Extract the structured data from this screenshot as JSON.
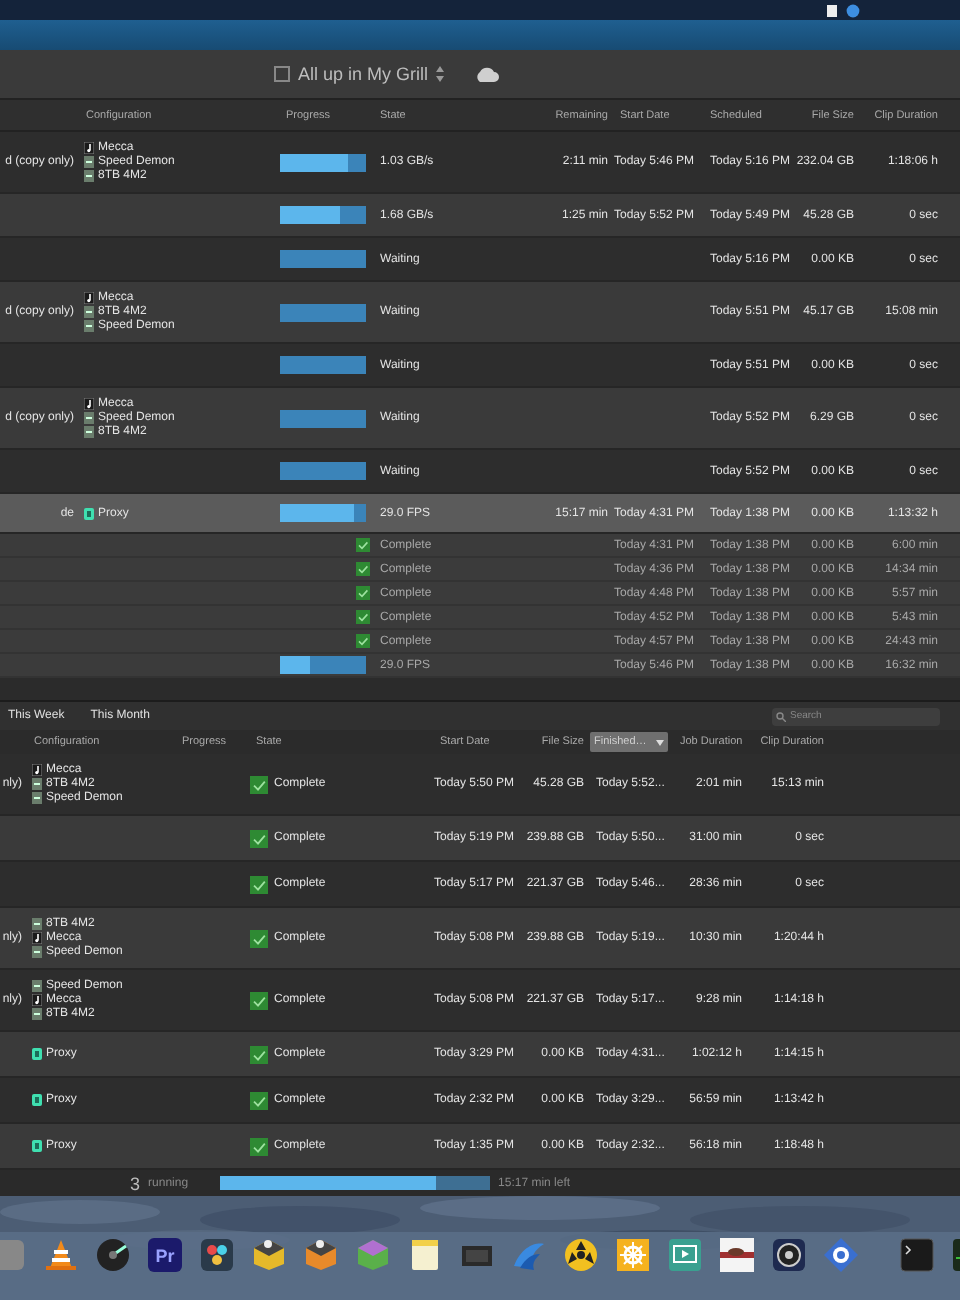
{
  "toolbar": {
    "title": "All up in My Grill"
  },
  "queue": {
    "columns": [
      "Configuration",
      "Progress",
      "State",
      "Remaining",
      "Start Date",
      "Scheduled",
      "File Size",
      "Clip Duration"
    ],
    "rows": [
      {
        "name": "d (copy only)",
        "config": [
          {
            "kind": "mecca",
            "label": "Mecca"
          },
          {
            "kind": "drive",
            "label": "Speed Demon"
          },
          {
            "kind": "drive",
            "label": "8TB 4M2"
          }
        ],
        "kind": "progress",
        "level": 0.8,
        "state": "1.03 GB/s",
        "remaining": "2:11 min",
        "start": "Today 5:46 PM",
        "scheduled": "Today 5:16 PM",
        "size": "232.04 GB",
        "clip": "1:18:06 h",
        "selected": false
      },
      {
        "kind": "progress",
        "level": 0.7,
        "state": "1.68 GB/s",
        "remaining": "1:25 min",
        "start": "Today 5:52 PM",
        "scheduled": "Today 5:49 PM",
        "size": "45.28 GB",
        "clip": "0 sec",
        "selected": false
      },
      {
        "kind": "waiting",
        "state": "Waiting",
        "scheduled": "Today 5:16 PM",
        "size": "0.00 KB",
        "clip": "0 sec",
        "selected": false
      },
      {
        "name": "d (copy only)",
        "config": [
          {
            "kind": "mecca",
            "label": "Mecca"
          },
          {
            "kind": "drive",
            "label": "8TB 4M2"
          },
          {
            "kind": "drive",
            "label": "Speed Demon"
          }
        ],
        "kind": "waiting",
        "state": "Waiting",
        "scheduled": "Today 5:51 PM",
        "size": "45.17 GB",
        "clip": "15:08 min",
        "selected": false
      },
      {
        "kind": "waiting",
        "state": "Waiting",
        "scheduled": "Today 5:51 PM",
        "size": "0.00 KB",
        "clip": "0 sec",
        "selected": false
      },
      {
        "name": "d (copy only)",
        "config": [
          {
            "kind": "mecca",
            "label": "Mecca"
          },
          {
            "kind": "drive",
            "label": "Speed Demon"
          },
          {
            "kind": "drive",
            "label": "8TB 4M2"
          }
        ],
        "kind": "waiting",
        "state": "Waiting",
        "scheduled": "Today 5:52 PM",
        "size": "6.29 GB",
        "clip": "0 sec",
        "selected": false
      },
      {
        "kind": "waiting",
        "state": "Waiting",
        "scheduled": "Today 5:52 PM",
        "size": "0.00 KB",
        "clip": "0 sec",
        "selected": false
      },
      {
        "name": "de",
        "config": [
          {
            "kind": "proxy",
            "label": "Proxy"
          }
        ],
        "kind": "progress",
        "level": 0.85,
        "state": "29.0 FPS",
        "remaining": "15:17 min",
        "start": "Today 4:31 PM",
        "scheduled": "Today 1:38 PM",
        "size": "0.00 KB",
        "clip": "1:13:32 h",
        "selected": true,
        "children": [
          {
            "kind": "complete",
            "state": "Complete",
            "start": "Today 4:31 PM",
            "scheduled": "Today 1:38 PM",
            "size": "0.00 KB",
            "clip": "6:00 min"
          },
          {
            "kind": "complete",
            "state": "Complete",
            "start": "Today 4:36 PM",
            "scheduled": "Today 1:38 PM",
            "size": "0.00 KB",
            "clip": "14:34 min"
          },
          {
            "kind": "complete",
            "state": "Complete",
            "start": "Today 4:48 PM",
            "scheduled": "Today 1:38 PM",
            "size": "0.00 KB",
            "clip": "5:57 min"
          },
          {
            "kind": "complete",
            "state": "Complete",
            "start": "Today 4:52 PM",
            "scheduled": "Today 1:38 PM",
            "size": "0.00 KB",
            "clip": "5:43 min"
          },
          {
            "kind": "complete",
            "state": "Complete",
            "start": "Today 4:57 PM",
            "scheduled": "Today 1:38 PM",
            "size": "0.00 KB",
            "clip": "24:43 min"
          },
          {
            "kind": "progress",
            "level": 0.35,
            "state": "29.0 FPS",
            "start": "Today 5:46 PM",
            "scheduled": "Today 1:38 PM",
            "size": "0.00 KB",
            "clip": "16:32 min"
          }
        ]
      }
    ]
  },
  "history": {
    "tabs": [
      {
        "label": "This Week",
        "selected": false
      },
      {
        "label": "This Month",
        "selected": false
      }
    ],
    "search_placeholder": "Search",
    "columns": [
      {
        "kind": "label",
        "label": "Configuration"
      },
      {
        "kind": "label",
        "label": "Progress"
      },
      {
        "kind": "label",
        "label": "State"
      },
      {
        "kind": "label",
        "label": "Start Date"
      },
      {
        "kind": "label",
        "label": "File Size"
      },
      {
        "kind": "menu",
        "label": "Finished…"
      },
      {
        "kind": "label",
        "label": "Job Duration"
      },
      {
        "kind": "label",
        "label": "Clip Duration"
      }
    ],
    "rows": [
      {
        "name": "nly)",
        "config": [
          {
            "kind": "mecca",
            "label": "Mecca"
          },
          {
            "kind": "drive",
            "label": "8TB 4M2"
          },
          {
            "kind": "drive",
            "label": "Speed Demon"
          }
        ],
        "kind": "complete",
        "state": "Complete",
        "start": "Today 5:50 PM",
        "size": "45.28 GB",
        "finished": "Today 5:52...",
        "job": "2:01 min",
        "clip": "15:13 min"
      },
      {
        "kind": "complete",
        "state": "Complete",
        "start": "Today 5:19 PM",
        "size": "239.88 GB",
        "finished": "Today 5:50...",
        "job": "31:00 min",
        "clip": "0 sec"
      },
      {
        "kind": "complete",
        "state": "Complete",
        "start": "Today 5:17 PM",
        "size": "221.37 GB",
        "finished": "Today 5:46...",
        "job": "28:36 min",
        "clip": "0 sec"
      },
      {
        "name": "nly)",
        "config": [
          {
            "kind": "drive",
            "label": "8TB 4M2"
          },
          {
            "kind": "mecca",
            "label": "Mecca"
          },
          {
            "kind": "drive",
            "label": "Speed Demon"
          }
        ],
        "kind": "complete",
        "state": "Complete",
        "start": "Today 5:08 PM",
        "size": "239.88 GB",
        "finished": "Today 5:19...",
        "job": "10:30 min",
        "clip": "1:20:44 h"
      },
      {
        "name": "nly)",
        "config": [
          {
            "kind": "drive",
            "label": "Speed Demon"
          },
          {
            "kind": "mecca",
            "label": "Mecca"
          },
          {
            "kind": "drive",
            "label": "8TB 4M2"
          }
        ],
        "kind": "complete",
        "state": "Complete",
        "start": "Today 5:08 PM",
        "size": "221.37 GB",
        "finished": "Today 5:17...",
        "job": "9:28 min",
        "clip": "1:14:18 h"
      },
      {
        "config": [
          {
            "kind": "proxy",
            "label": "Proxy"
          }
        ],
        "kind": "complete",
        "state": "Complete",
        "start": "Today 3:29 PM",
        "size": "0.00 KB",
        "finished": "Today 4:31...",
        "job": "1:02:12 h",
        "clip": "1:14:15 h"
      },
      {
        "config": [
          {
            "kind": "proxy",
            "label": "Proxy"
          }
        ],
        "kind": "complete",
        "state": "Complete",
        "start": "Today 2:32 PM",
        "size": "0.00 KB",
        "finished": "Today 3:29...",
        "job": "56:59 min",
        "clip": "1:13:42 h"
      },
      {
        "config": [
          {
            "kind": "proxy",
            "label": "Proxy"
          }
        ],
        "kind": "complete",
        "state": "Complete",
        "start": "Today 1:35 PM",
        "size": "0.00 KB",
        "finished": "Today 2:32...",
        "job": "56:18 min",
        "clip": "1:18:48 h"
      }
    ]
  },
  "status_bar": {
    "count": "3",
    "label": "running",
    "level": 0.8,
    "remaining": "15:17 min left"
  },
  "dock": {
    "premiere_label": "Pr"
  }
}
